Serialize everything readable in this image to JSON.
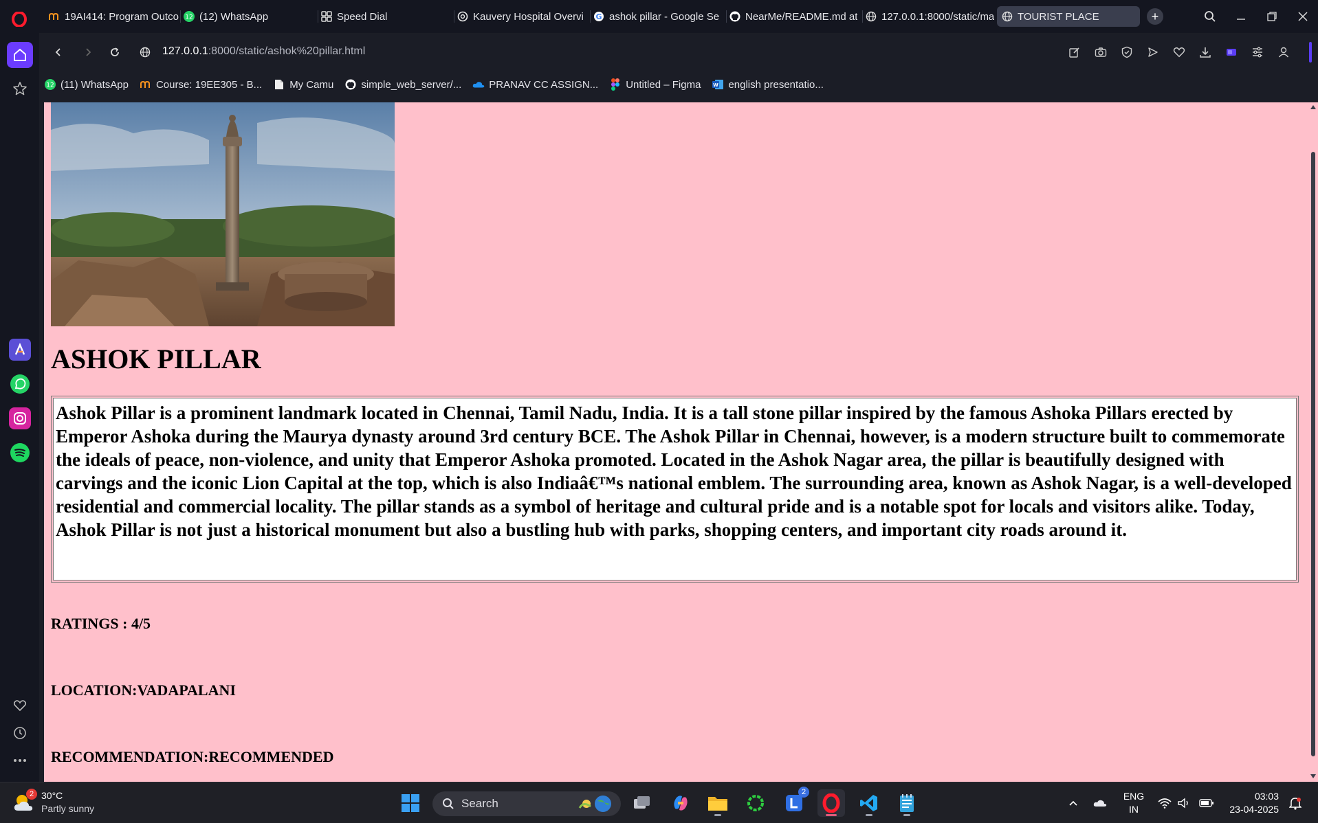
{
  "browser": {
    "tabs": [
      {
        "label": "19AI414: Program Outco",
        "icon": "moodle-icon"
      },
      {
        "label": "(12) WhatsApp",
        "icon": "whatsapp-icon"
      },
      {
        "label": "Speed Dial",
        "icon": "speed-dial-icon"
      },
      {
        "label": "Kauvery Hospital Overvi",
        "icon": "chatgpt-icon"
      },
      {
        "label": "ashok pillar - Google Se",
        "icon": "google-icon"
      },
      {
        "label": "NearMe/README.md at",
        "icon": "github-icon"
      },
      {
        "label": "127.0.0.1:8000/static/ma",
        "icon": "globe-icon"
      },
      {
        "label": "TOURIST PLACE",
        "icon": "globe-icon",
        "active": true
      }
    ],
    "url": {
      "host": "127.0.0.1",
      "path": ":8000/static/ashok%20pillar.html"
    },
    "bookmarks": [
      {
        "label": "(11) WhatsApp",
        "icon": "whatsapp-icon"
      },
      {
        "label": "Course: 19EE305 - B...",
        "icon": "moodle-icon"
      },
      {
        "label": "My Camu",
        "icon": "document-icon"
      },
      {
        "label": "simple_web_server/...",
        "icon": "github-icon"
      },
      {
        "label": "PRANAV CC ASSIGN...",
        "icon": "onedrive-icon"
      },
      {
        "label": "Untitled – Figma",
        "icon": "figma-icon"
      },
      {
        "label": "english presentatio...",
        "icon": "word-icon"
      }
    ]
  },
  "page": {
    "heading": "ASHOK PILLAR",
    "description": "Ashok Pillar is a prominent landmark located in Chennai, Tamil Nadu, India. It is a tall stone pillar inspired by the famous Ashoka Pillars erected by Emperor Ashoka during the Maurya dynasty around 3rd century BCE. The Ashok Pillar in Chennai, however, is a modern structure built to commemorate the ideals of peace, non-violence, and unity that Emperor Ashoka promoted. Located in the Ashok Nagar area, the pillar is beautifully designed with carvings and the iconic Lion Capital at the top, which is also Indiaâ€™s national emblem. The surrounding area, known as Ashok Nagar, is a well-developed residential and commercial locality. The pillar stands as a symbol of heritage and cultural pride and is a notable spot for locals and visitors alike. Today, Ashok Pillar is not just a historical monument but also a bustling hub with parks, shopping centers, and important city roads around it.",
    "ratings": "RATINGS : 4/5",
    "location": "LOCATION:VADAPALANI",
    "recommendation": "RECOMMENDATION:RECOMMENDED",
    "background_color": "#ffc0cb"
  },
  "taskbar": {
    "weather_temp": "30°C",
    "weather_desc": "Partly sunny",
    "weather_badge": "2",
    "search_label": "Search",
    "app_badge": "2",
    "lang_line1": "ENG",
    "lang_line2": "IN",
    "time": "03:03",
    "date": "23-04-2025"
  }
}
